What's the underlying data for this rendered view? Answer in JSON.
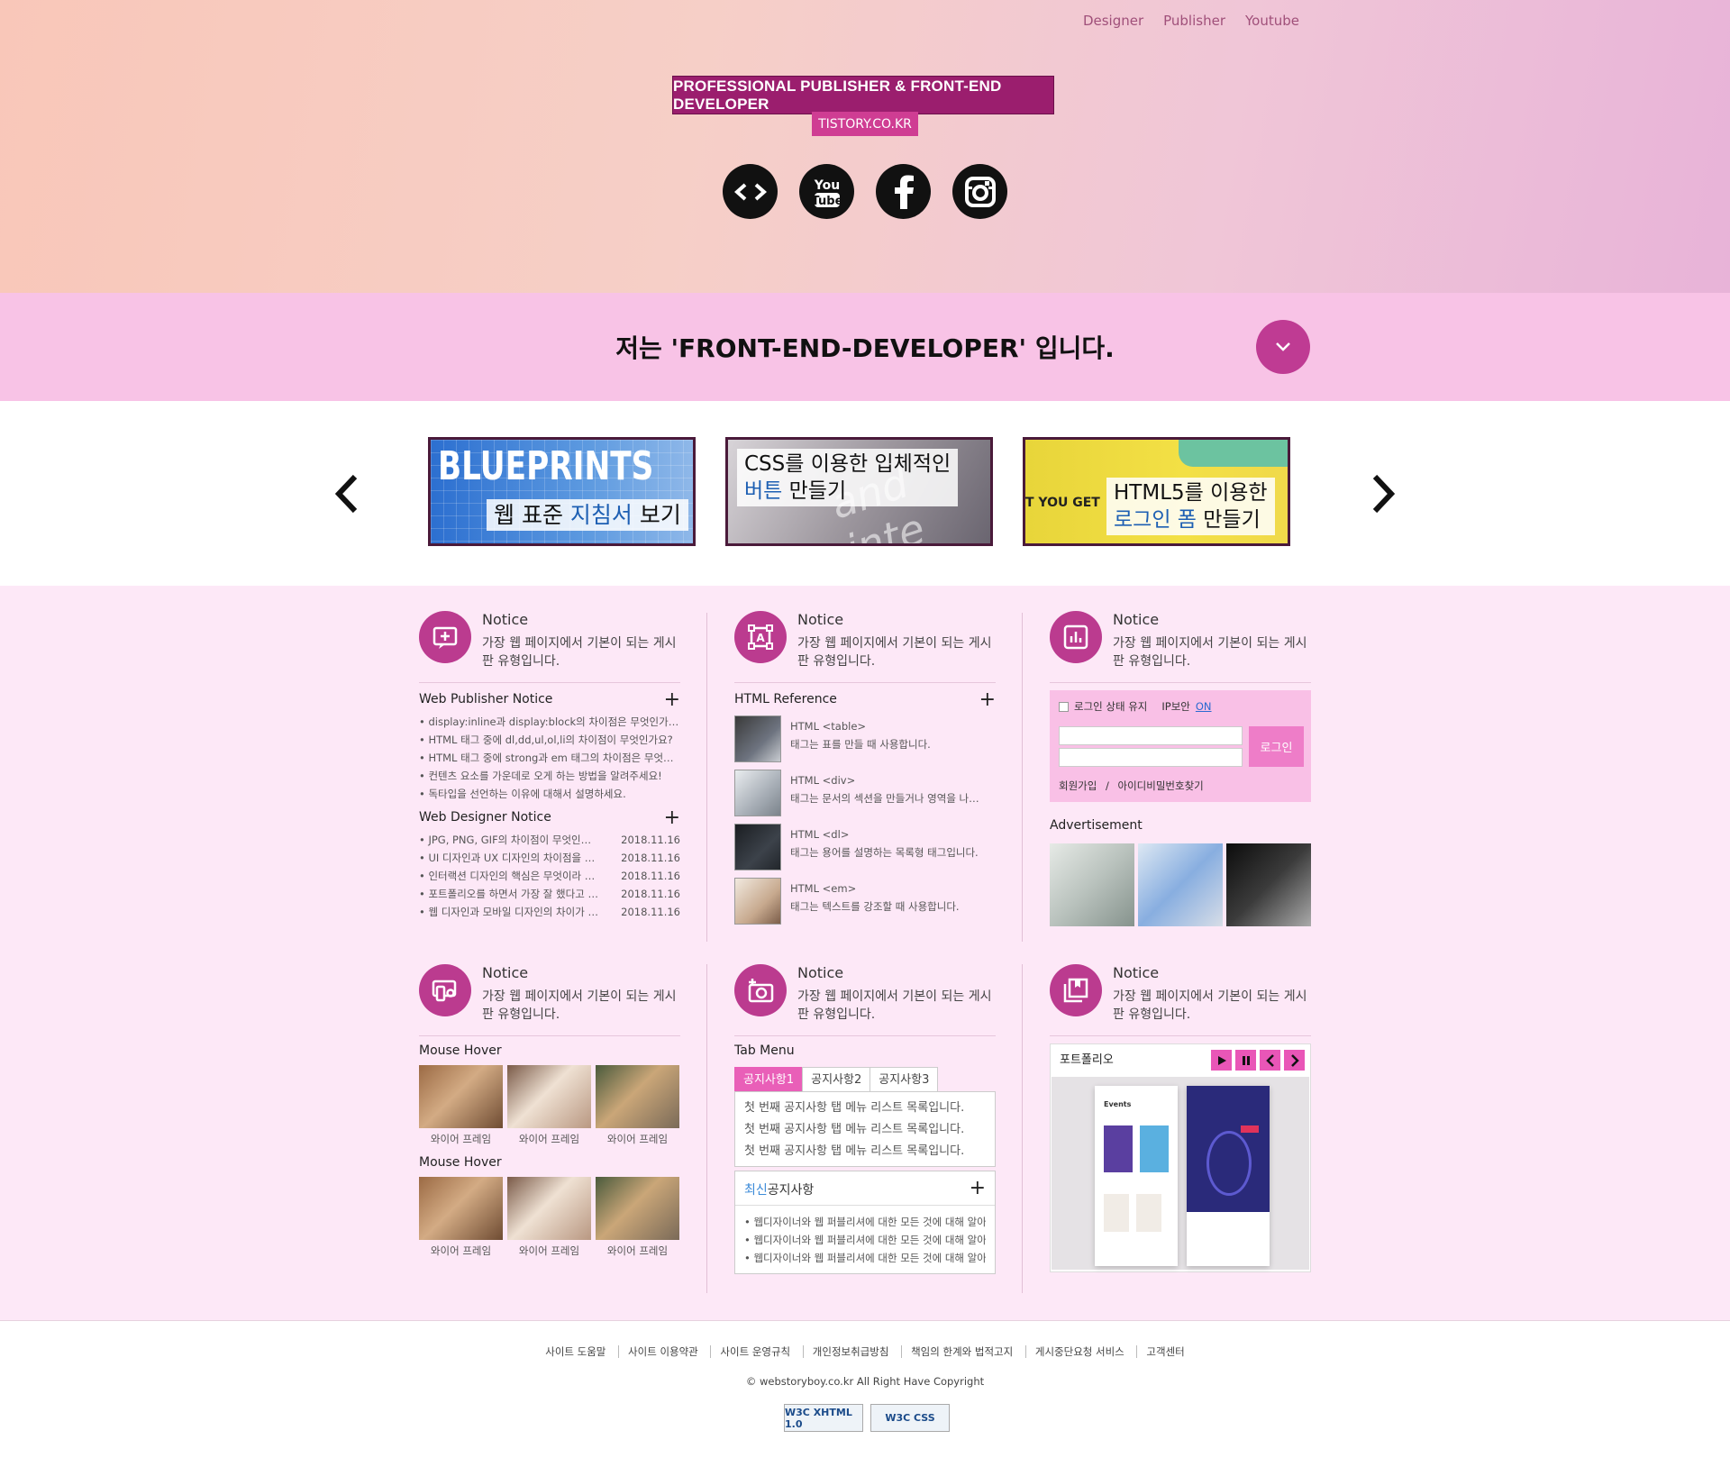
{
  "nav": {
    "items": [
      "Designer",
      "Publisher",
      "Youtube"
    ]
  },
  "header": {
    "title": "PROFESSIONAL PUBLISHER & FRONT-END DEVELOPER",
    "subtitle": "TISTORY.CO.KR",
    "social_icons": [
      "code-icon",
      "youtube-icon",
      "facebook-icon",
      "instagram-icon"
    ]
  },
  "band": {
    "text": "저는 'FRONT-END-DEVELOPER' 입니다."
  },
  "slides": [
    {
      "top_text": "BLUEPRINTS",
      "cap_a": "웹 표준 ",
      "cap_hl": "지침서",
      "cap_b": " 보기"
    },
    {
      "top_text": "",
      "cap_line1": "CSS를 이용한 입체적인",
      "cap_hl": "버튼",
      "cap_b": " 만들기"
    },
    {
      "top_text": "T YOU GET",
      "cap_line1": "HTML5를 이용한",
      "cap_hl": "로그인 폼",
      "cap_b": " 만들기"
    }
  ],
  "notice": {
    "title": "Notice",
    "desc": "가장 웹 페이지에서 기본이 되는 게시판 유형입니다."
  },
  "publisher": {
    "title": "Web Publisher Notice",
    "items": [
      "display:inline과 display:block의 차이점은 무엇인가요?",
      "HTML 태그 중에 dl,dd,ul,ol,li의 차이점이 무엇인가요?",
      "HTML 태그 중에 strong과 em 태그의 차이점은 무엇인가요?",
      "컨텐츠 요소를 가운데로 오게 하는 방법을 알려주세요!",
      "독타입을 선언하는 이유에 대해서 설명하세요."
    ]
  },
  "designer": {
    "title": "Web Designer Notice",
    "items": [
      {
        "text": "JPG, PNG, GIF의 차이점이 무엇인가요?",
        "date": "2018.11.16"
      },
      {
        "text": "UI 디자인과 UX 디자인의 차이점을 설명하세요",
        "date": "2018.11.16"
      },
      {
        "text": "인터랙션 디자인의 핵심은 무엇이라 생각하나요?",
        "date": "2018.11.16"
      },
      {
        "text": "포트폴리오를 하면서 가장 잘 했다고 생각하는 것은?",
        "date": "2018.11.16"
      },
      {
        "text": "웹 디자인과 모바일 디자인의 차이가 무엇인가요?",
        "date": "2018.11.16"
      }
    ]
  },
  "reference": {
    "title": "HTML Reference",
    "items": [
      {
        "tag": "HTML <table>",
        "desc": "태그는 표를 만들 때 사용합니다."
      },
      {
        "tag": "HTML <div>",
        "desc": "태그는 문서의 섹션을 만들거나 영역을 나눌 때 사용합니다."
      },
      {
        "tag": "HTML <dl>",
        "desc": "태그는 용어를 설명하는 목록형 태그입니다."
      },
      {
        "tag": "HTML <em>",
        "desc": "태그는 텍스트를 강조할 때 사용합니다."
      }
    ]
  },
  "login": {
    "keep": "로그인 상태 유지",
    "ip": "IP보안",
    "ip_on": "ON",
    "button": "로그인",
    "join": "회원가입",
    "sep": "/",
    "find": "아이디비밀번호찾기"
  },
  "ad": {
    "title": "Advertisement"
  },
  "hover": {
    "title1": "Mouse Hover",
    "title2": "Mouse Hover",
    "labels": [
      "와이어 프레임",
      "와이어 프레임",
      "와이어 프레임"
    ]
  },
  "tabmenu": {
    "title": "Tab Menu",
    "tabs": [
      "공지사항1",
      "공지사항2",
      "공지사항3"
    ],
    "items": [
      "첫 번째 공지사항 탭 메뉴 리스트 목록입니다.",
      "첫 번째 공지사항 탭 메뉴 리스트 목록입니다.",
      "첫 번째 공지사항 탭 메뉴 리스트 목록입니다."
    ],
    "latest_hl": "최신",
    "latest_rest": "공지사항",
    "latest_items": [
      "웹디자이너와 웹 퍼블리셔에 대한 모든 것에 대해 알아봅니다.",
      "웹디자이너와 웹 퍼블리셔에 대한 모든 것에 대해 알아봅니다.",
      "웹디자이너와 웹 퍼블리셔에 대한 모든 것에 대해 알아봅니다."
    ]
  },
  "portfolio": {
    "title": "포트폴리오",
    "events_label": "Events"
  },
  "footer": {
    "links": [
      "사이트 도움말",
      "사이트 이용약관",
      "사이트 운영규칙",
      "개인정보취급방침",
      "책임의 한계와 법적고지",
      "게시중단요청 서비스",
      "고객센터"
    ],
    "copyright": "© webstoryboy.co.kr All Right Have Copyright",
    "badge1": "W3C XHTML 1.0",
    "badge2": "W3C CSS"
  },
  "colors": {
    "accent": "#bb3b8f",
    "band": "#f8c3e6",
    "main_bg": "#fde8f7",
    "title_bg": "#9b1e6e"
  }
}
